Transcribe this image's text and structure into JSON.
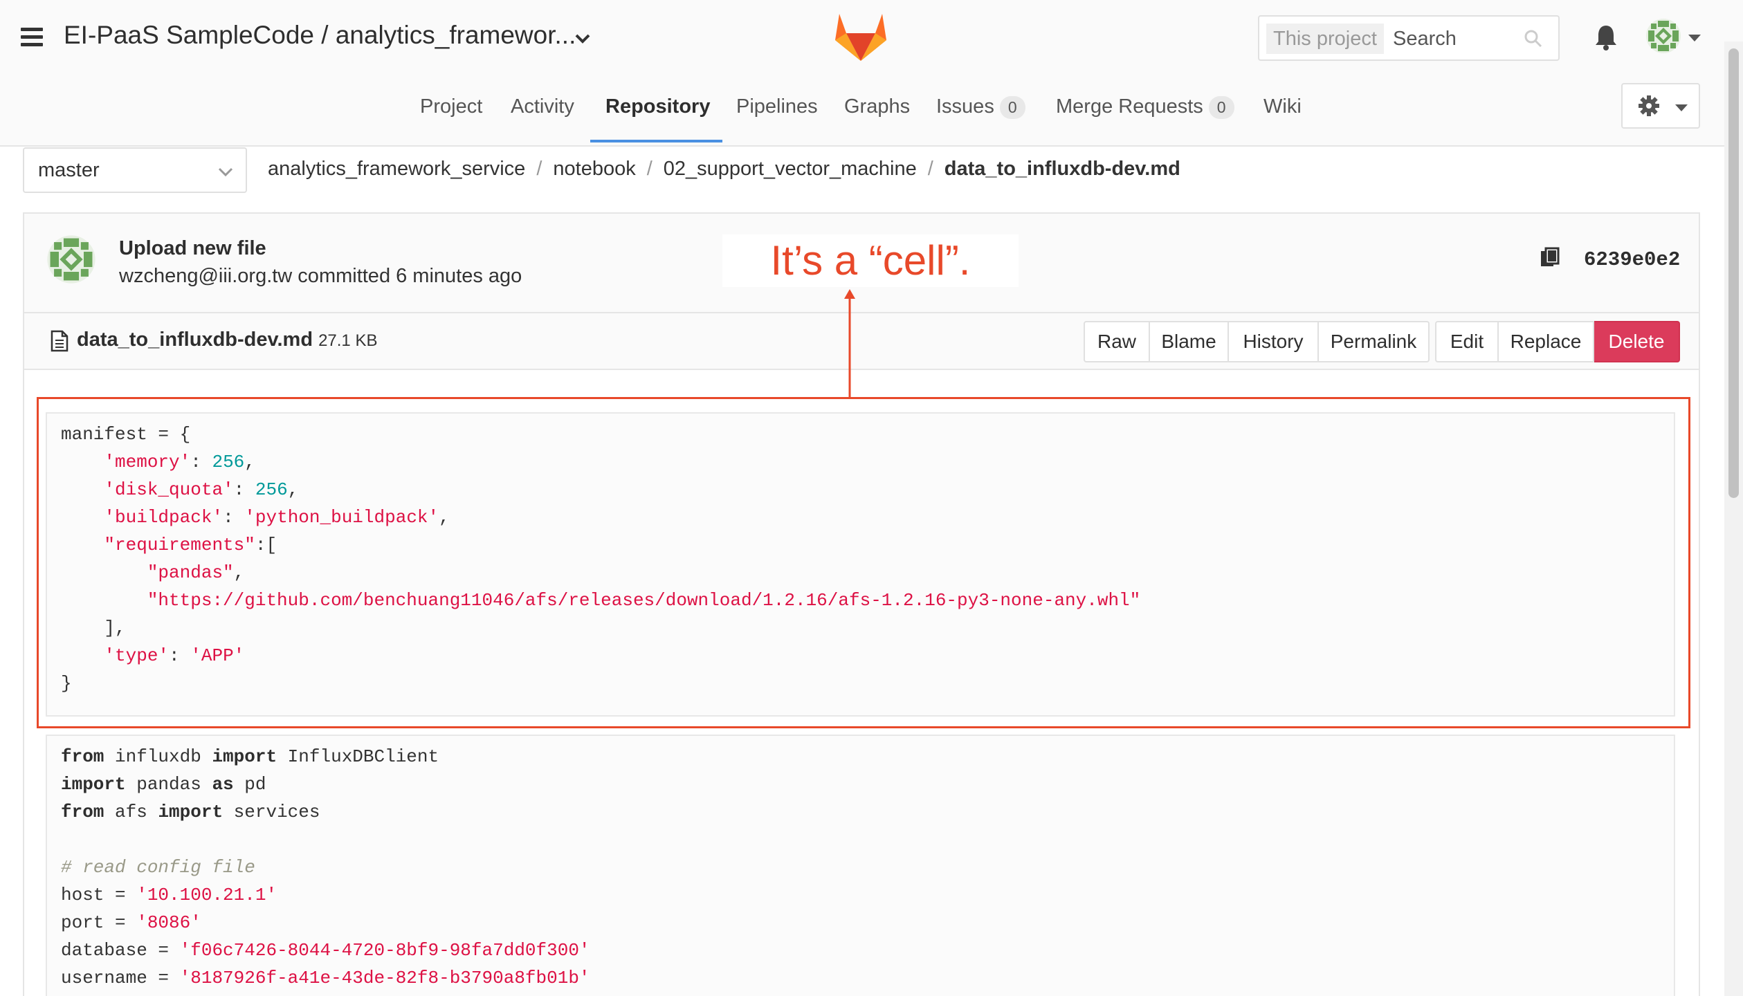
{
  "header": {
    "title": "EI-PaaS SampleCode / analytics_framewor...",
    "search_scope": "This project",
    "search_placeholder": "Search"
  },
  "nav": {
    "tabs": [
      {
        "label": "Project"
      },
      {
        "label": "Activity"
      },
      {
        "label": "Repository",
        "active": true
      },
      {
        "label": "Pipelines"
      },
      {
        "label": "Graphs"
      },
      {
        "label": "Issues",
        "count": "0"
      },
      {
        "label": "Merge Requests",
        "count": "0"
      },
      {
        "label": "Wiki"
      }
    ]
  },
  "branch": {
    "selected": "master"
  },
  "breadcrumb": [
    "analytics_framework_service",
    "notebook",
    "02_support_vector_machine",
    "data_to_influxdb-dev.md"
  ],
  "commit": {
    "message": "Upload new file",
    "meta": "wzcheng@iii.org.tw committed 6 minutes ago",
    "sha": "6239e0e2"
  },
  "file": {
    "name": "data_to_influxdb-dev.md",
    "size": "27.1 KB",
    "buttons": [
      "Raw",
      "Blame",
      "History",
      "Permalink",
      "Edit",
      "Replace",
      "Delete"
    ]
  },
  "annotation": {
    "text": "It’s a “cell”."
  },
  "code_cell_1": [
    "manifest = {",
    "    'memory': 256,",
    "    'disk_quota': 256,",
    "    'buildpack': 'python_buildpack',",
    "    \"requirements\":[",
    "        \"pandas\",",
    "        \"https://github.com/benchuang11046/afs/releases/download/1.2.16/afs-1.2.16-py3-none-any.whl\"",
    "    ],",
    "    'type': 'APP'",
    "}"
  ],
  "code_cell_2": [
    "from influxdb import InfluxDBClient",
    "import pandas as pd",
    "from afs import services",
    "",
    "# read config file",
    "host = '10.100.21.1'",
    "port = '8086'",
    "database = 'f06c7426-8044-4720-8bf9-98fa7dd0f300'",
    "username = '8187926f-a41e-43de-82f8-b3790a8fb01b'"
  ],
  "colors": {
    "accent": "#4a90e2",
    "danger": "#db3b5b",
    "annotation": "#e8492a"
  }
}
